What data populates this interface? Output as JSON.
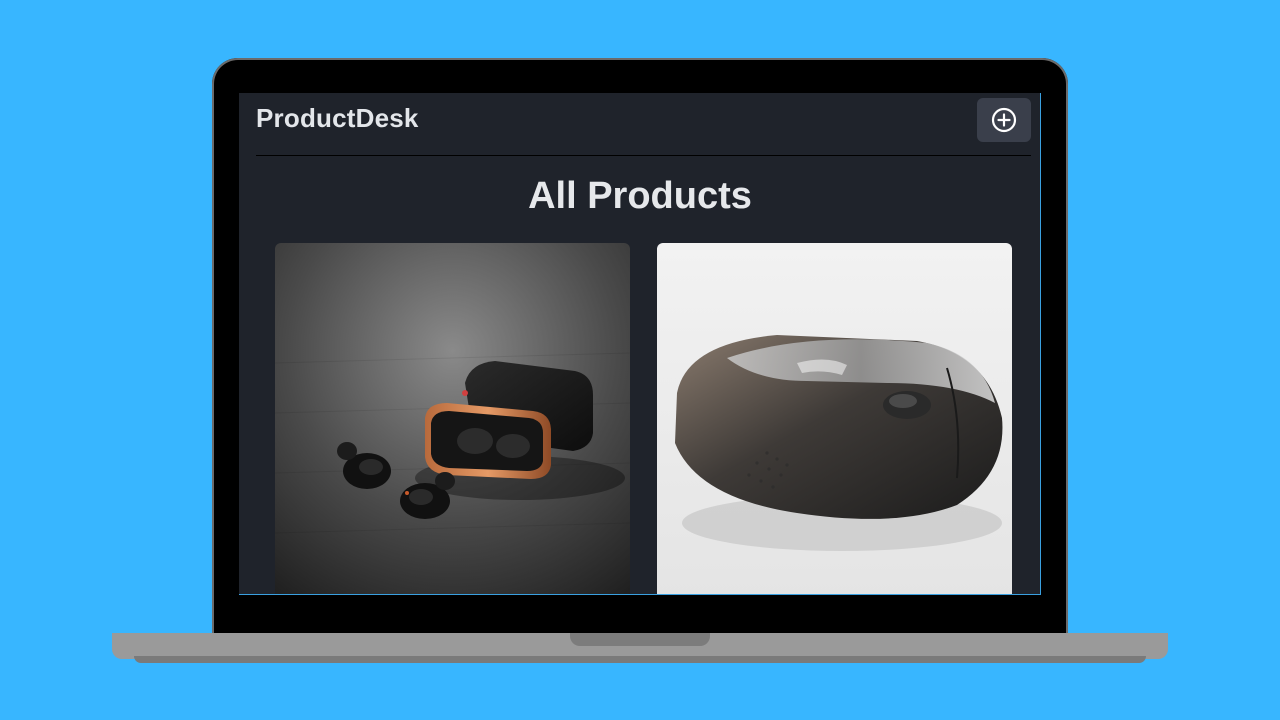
{
  "app": {
    "brand": "ProductDesk",
    "add_icon": "plus-circle-icon"
  },
  "main": {
    "title": "All Products",
    "products": [
      {
        "image": "wireless-earbuds-with-charging-case"
      },
      {
        "image": "wireless-computer-mouse"
      }
    ]
  },
  "colors": {
    "background": "#38b6ff",
    "app_bg": "#1f232b",
    "button_bg": "#3a3f4b",
    "text": "#e3e6ea"
  }
}
